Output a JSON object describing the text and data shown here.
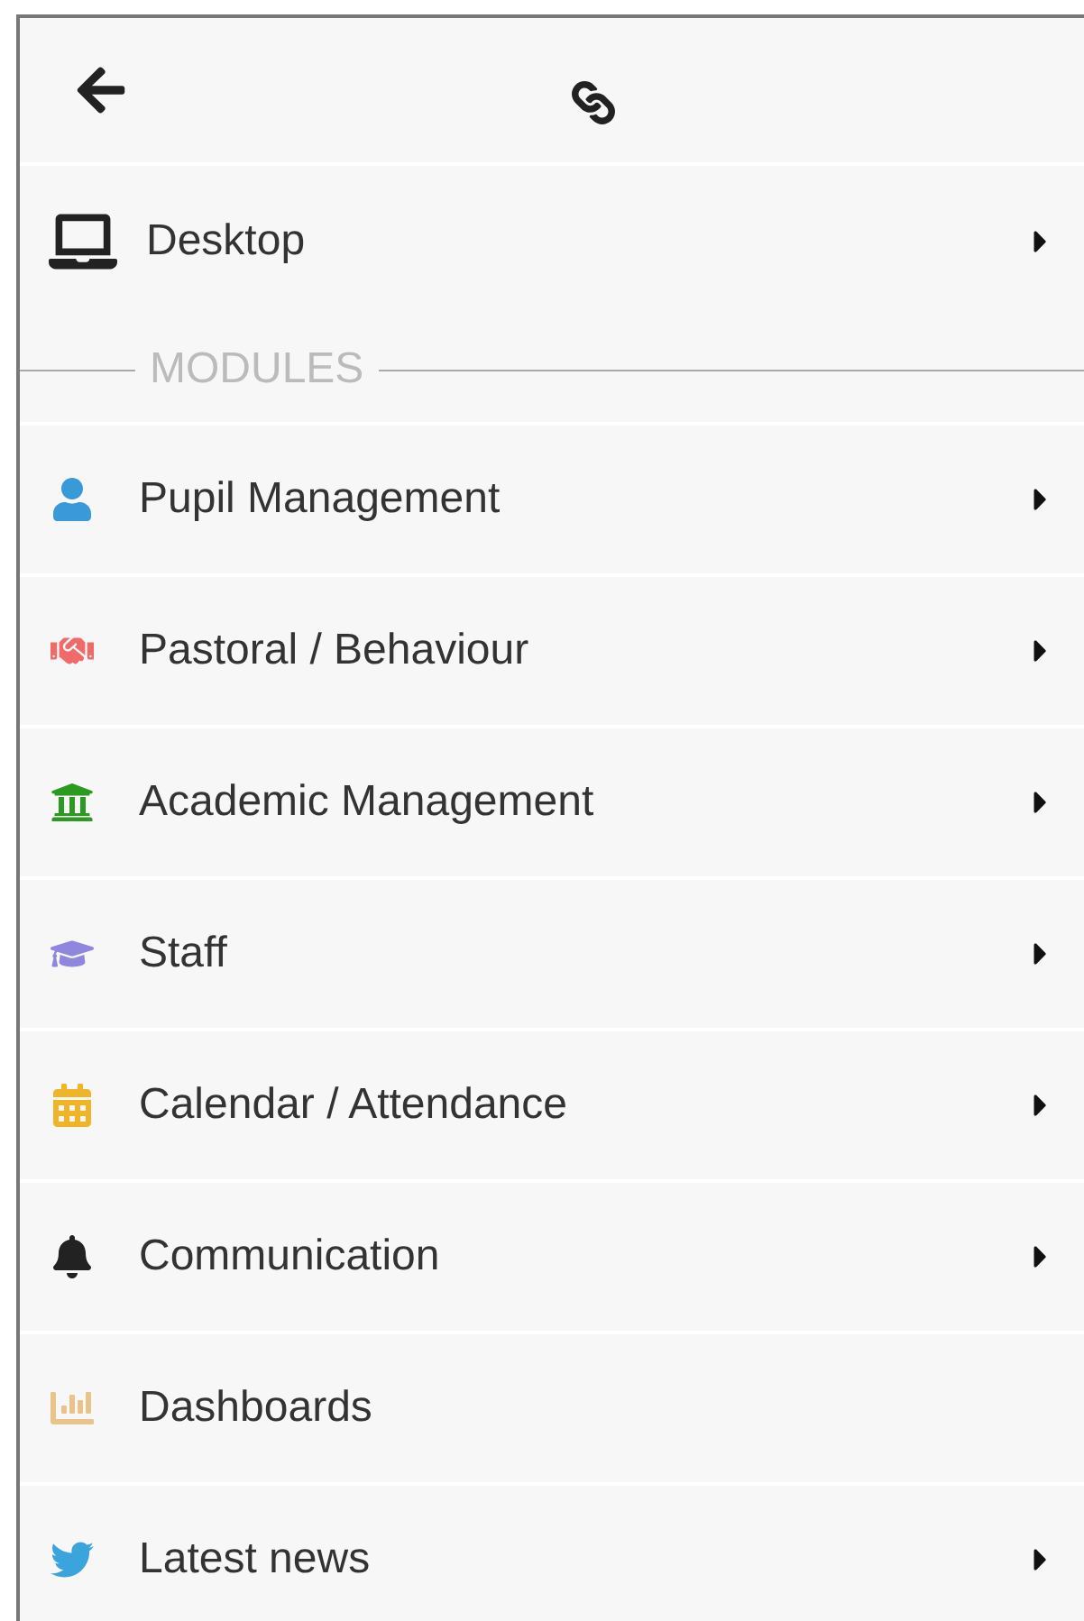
{
  "desktop": {
    "label": "Desktop",
    "expandable": true
  },
  "section_label": "MODULES",
  "modules": [
    {
      "label": "Pupil Management",
      "color": "#3a9ad9",
      "expandable": true
    },
    {
      "label": "Pastoral / Behaviour",
      "color": "#f06a6a",
      "expandable": true
    },
    {
      "label": "Academic Management",
      "color": "#2a9a20",
      "expandable": true
    },
    {
      "label": "Staff",
      "color": "#8f86e0",
      "expandable": true
    },
    {
      "label": "Calendar / Attendance",
      "color": "#f0b429",
      "expandable": true
    },
    {
      "label": "Communication",
      "color": "#222222",
      "expandable": true
    },
    {
      "label": "Dashboards",
      "color": "#e8c48a",
      "expandable": false
    },
    {
      "label": "Latest news",
      "color": "#3aa5dd",
      "expandable": true
    }
  ]
}
